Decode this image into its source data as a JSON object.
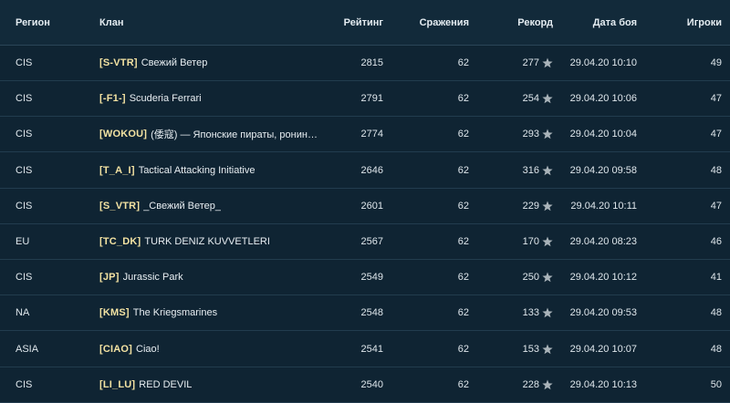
{
  "header": {
    "region": "Регион",
    "clan": "Клан",
    "rating": "Рейтинг",
    "battles": "Сражения",
    "record": "Рекорд",
    "date": "Дата боя",
    "players": "Игроки"
  },
  "rows": [
    {
      "region": "CIS",
      "tag": "[S-VTR]",
      "name": "Свежий Ветер",
      "rating": "2815",
      "battles": "62",
      "record": "277",
      "date": "29.04.20 10:10",
      "players": "49"
    },
    {
      "region": "CIS",
      "tag": "[-F1-]",
      "name": "Scuderia Ferrari",
      "rating": "2791",
      "battles": "62",
      "record": "254",
      "date": "29.04.20 10:06",
      "players": "47"
    },
    {
      "region": "CIS",
      "tag": "[WOKOU]",
      "name": "(倭寇) — Японские пираты, ронины и конт…",
      "rating": "2774",
      "battles": "62",
      "record": "293",
      "date": "29.04.20 10:04",
      "players": "47"
    },
    {
      "region": "CIS",
      "tag": "[T_A_I]",
      "name": "Tactical Attacking Initiative",
      "rating": "2646",
      "battles": "62",
      "record": "316",
      "date": "29.04.20 09:58",
      "players": "48"
    },
    {
      "region": "CIS",
      "tag": "[S_VTR]",
      "name": "_Свежий Ветер_",
      "rating": "2601",
      "battles": "62",
      "record": "229",
      "date": "29.04.20 10:11",
      "players": "47"
    },
    {
      "region": "EU",
      "tag": "[TC_DK]",
      "name": "TURK DENIZ KUVVETLERI",
      "rating": "2567",
      "battles": "62",
      "record": "170",
      "date": "29.04.20 08:23",
      "players": "46"
    },
    {
      "region": "CIS",
      "tag": "[JP]",
      "name": "Jurassic Park",
      "rating": "2549",
      "battles": "62",
      "record": "250",
      "date": "29.04.20 10:12",
      "players": "41"
    },
    {
      "region": "NA",
      "tag": "[KMS]",
      "name": "The Kriegsmarines",
      "rating": "2548",
      "battles": "62",
      "record": "133",
      "date": "29.04.20 09:53",
      "players": "48"
    },
    {
      "region": "ASIA",
      "tag": "[CIAO]",
      "name": "Ciao!",
      "rating": "2541",
      "battles": "62",
      "record": "153",
      "date": "29.04.20 10:07",
      "players": "48"
    },
    {
      "region": "CIS",
      "tag": "[LI_LU]",
      "name": "RED DEVIL",
      "rating": "2540",
      "battles": "62",
      "record": "228",
      "date": "29.04.20 10:13",
      "players": "50"
    }
  ],
  "icons": {
    "record": "star-icon"
  },
  "colors": {
    "background": "#0f2433",
    "tag": "#f3e2a2",
    "text": "#dfe7ec"
  }
}
